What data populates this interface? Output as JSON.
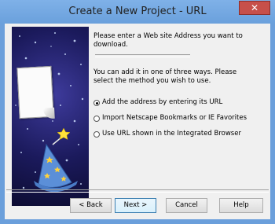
{
  "window": {
    "title": "Create a New Project - URL",
    "close_glyph": "✕"
  },
  "intro": {
    "line1": "Please enter a Web site Address you want to download.",
    "line2": "You can add it in one of three ways. Please select the method you wish to use."
  },
  "options": [
    {
      "label": "Add the address by entering its URL",
      "checked": true
    },
    {
      "label": "Import Netscape Bookmarks or IE Favorites",
      "checked": false
    },
    {
      "label": "Use URL shown in the Integrated Browser",
      "checked": false
    }
  ],
  "buttons": {
    "back": "< Back",
    "next": "Next >",
    "cancel": "Cancel",
    "help": "Help"
  }
}
